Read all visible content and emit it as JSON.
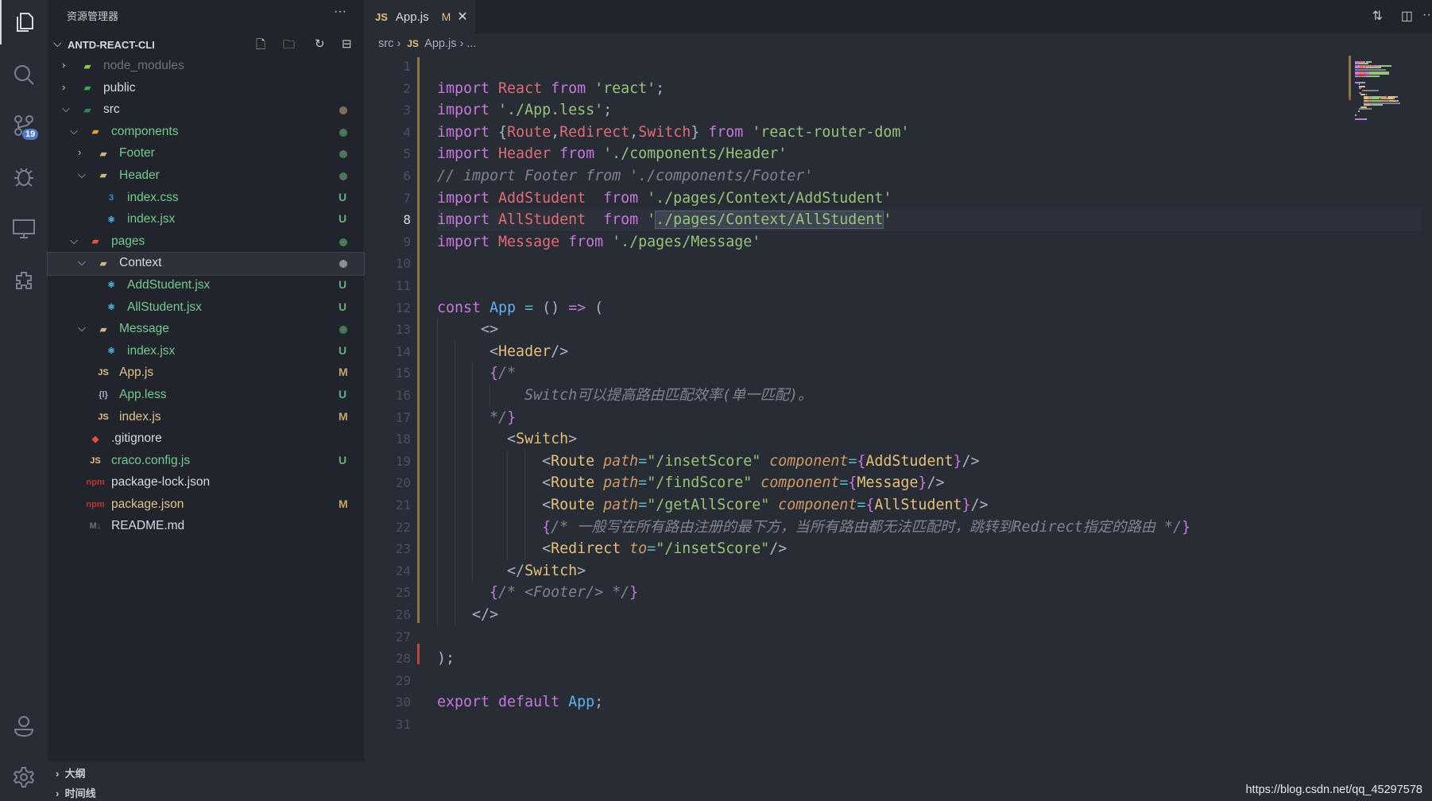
{
  "activity_bar": {
    "items": [
      {
        "icon": "files-icon",
        "active": true
      },
      {
        "icon": "search-icon"
      },
      {
        "icon": "source-control-icon",
        "badge": "19"
      },
      {
        "icon": "debug-icon"
      },
      {
        "icon": "remote-explorer-icon"
      },
      {
        "icon": "extensions-icon"
      }
    ],
    "bottom": [
      {
        "icon": "account-icon"
      },
      {
        "icon": "settings-gear-icon"
      }
    ]
  },
  "sidebar": {
    "title": "资源管理器",
    "more": "···",
    "project": "ANTD-REACT-CLI",
    "tree": [
      {
        "name": "node_modules",
        "depth": 0,
        "kind": "folder",
        "open": false,
        "icon": "nodejs-folder-icon",
        "color": "#6b717d"
      },
      {
        "name": "public",
        "depth": 0,
        "kind": "folder",
        "open": false,
        "icon": "public-folder-icon",
        "color": "#d7dae0"
      },
      {
        "name": "src",
        "depth": 0,
        "kind": "folder",
        "open": true,
        "icon": "src-folder-icon",
        "color": "#d7dae0",
        "dot": "#7d6f5e"
      },
      {
        "name": "components",
        "depth": 1,
        "kind": "folder",
        "open": true,
        "icon": "components-folder-icon",
        "color": "#73c991",
        "dot": "#4b7a5a"
      },
      {
        "name": "Footer",
        "depth": 2,
        "kind": "folder",
        "open": false,
        "icon": "folder-icon",
        "color": "#73c991",
        "dot": "#4b7a5a"
      },
      {
        "name": "Header",
        "depth": 2,
        "kind": "folder",
        "open": true,
        "icon": "folder-open-icon",
        "color": "#73c991",
        "dot": "#4b7a5a"
      },
      {
        "name": "index.css",
        "depth": 3,
        "kind": "file",
        "icon": "css-icon",
        "color": "#73c991",
        "status": "U"
      },
      {
        "name": "index.jsx",
        "depth": 3,
        "kind": "file",
        "icon": "react-icon",
        "color": "#73c991",
        "status": "U"
      },
      {
        "name": "pages",
        "depth": 1,
        "kind": "folder",
        "open": true,
        "icon": "pages-folder-icon",
        "color": "#73c991",
        "dot": "#4b7a5a"
      },
      {
        "name": "Context",
        "depth": 2,
        "kind": "folder",
        "open": true,
        "icon": "folder-open-icon",
        "color": "#d7dae0",
        "dot": "#8a8f98",
        "selected": true
      },
      {
        "name": "AddStudent.jsx",
        "depth": 3,
        "kind": "file",
        "icon": "react-icon",
        "color": "#73c991",
        "status": "U"
      },
      {
        "name": "AllStudent.jsx",
        "depth": 3,
        "kind": "file",
        "icon": "react-icon",
        "color": "#73c991",
        "status": "U"
      },
      {
        "name": "Message",
        "depth": 2,
        "kind": "folder",
        "open": true,
        "icon": "folder-open-icon",
        "color": "#73c991",
        "dot": "#4b7a5a"
      },
      {
        "name": "index.jsx",
        "depth": 3,
        "kind": "file",
        "icon": "react-icon",
        "color": "#73c991",
        "status": "U"
      },
      {
        "name": "App.js",
        "depth": 2,
        "kind": "file",
        "icon": "js-icon",
        "color": "#e2c08d",
        "status": "M"
      },
      {
        "name": "App.less",
        "depth": 2,
        "kind": "file",
        "icon": "less-icon",
        "color": "#73c991",
        "status": "U"
      },
      {
        "name": "index.js",
        "depth": 2,
        "kind": "file",
        "icon": "js-icon",
        "color": "#e2c08d",
        "status": "M"
      },
      {
        "name": ".gitignore",
        "depth": 1,
        "kind": "file",
        "icon": "git-icon",
        "color": "#d7dae0"
      },
      {
        "name": "craco.config.js",
        "depth": 1,
        "kind": "file",
        "icon": "js-icon",
        "color": "#73c991",
        "status": "U"
      },
      {
        "name": "package-lock.json",
        "depth": 1,
        "kind": "file",
        "icon": "npm-icon",
        "color": "#d7dae0"
      },
      {
        "name": "package.json",
        "depth": 1,
        "kind": "file",
        "icon": "npm-icon",
        "color": "#e2c08d",
        "status": "M"
      },
      {
        "name": "README.md",
        "depth": 1,
        "kind": "file",
        "icon": "markdown-icon",
        "color": "#d7dae0"
      }
    ],
    "panels": [
      "大纲",
      "时间线"
    ]
  },
  "tab": {
    "icon": "JS",
    "label": "App.js",
    "status": "M",
    "close": "✕"
  },
  "breadcrumb": {
    "folder": "src",
    "icon": "JS",
    "file": "App.js",
    "rest": "..."
  },
  "editor": {
    "current_line": 8,
    "lines": [
      [],
      [
        [
          "import ",
          "k"
        ],
        [
          "React ",
          "v"
        ],
        [
          "from ",
          "k"
        ],
        [
          "'react'",
          "s"
        ],
        [
          ";",
          "p"
        ]
      ],
      [
        [
          "import ",
          "k"
        ],
        [
          "'./App.less'",
          "s"
        ],
        [
          ";",
          "p"
        ]
      ],
      [
        [
          "import ",
          "k"
        ],
        [
          "{",
          "p"
        ],
        [
          "Route",
          "v"
        ],
        [
          ",",
          "p"
        ],
        [
          "Redirect",
          "v"
        ],
        [
          ",",
          "p"
        ],
        [
          "Switch",
          "v"
        ],
        [
          "} ",
          "p"
        ],
        [
          "from ",
          "k"
        ],
        [
          "'react-router-dom'",
          "s"
        ]
      ],
      [
        [
          "import ",
          "k"
        ],
        [
          "Header ",
          "v"
        ],
        [
          "from ",
          "k"
        ],
        [
          "'./components/Header'",
          "s"
        ]
      ],
      [
        [
          "// import Footer from './components/Footer'",
          "c"
        ]
      ],
      [
        [
          "import ",
          "k"
        ],
        [
          "AddStudent  ",
          "v"
        ],
        [
          "from ",
          "k"
        ],
        [
          "'./pages/Context/AddStudent'",
          "s"
        ]
      ],
      [
        [
          "import ",
          "k"
        ],
        [
          "AllStudent  ",
          "v"
        ],
        [
          "from ",
          "k"
        ],
        [
          "'",
          "s"
        ],
        [
          "./pages/Context/AllStudent",
          "s sel"
        ],
        [
          "'",
          "s"
        ]
      ],
      [
        [
          "import ",
          "k"
        ],
        [
          "Message ",
          "v"
        ],
        [
          "from ",
          "k"
        ],
        [
          "'./pages/Message'",
          "s"
        ]
      ],
      [],
      [],
      [
        [
          "const ",
          "k"
        ],
        [
          "App ",
          "f"
        ],
        [
          "= ",
          "o"
        ],
        [
          "() ",
          "p"
        ],
        [
          "=> ",
          "k"
        ],
        [
          "(",
          "p"
        ]
      ],
      [
        [
          "     <>",
          "p"
        ]
      ],
      [
        [
          "      <",
          "p"
        ],
        [
          "Header",
          "t"
        ],
        [
          "/>",
          "p"
        ]
      ],
      [
        [
          "      {",
          "b"
        ],
        [
          "/*",
          "c"
        ]
      ],
      [
        [
          "          Switch可以提高路由匹配效率(单一匹配)。",
          "c"
        ]
      ],
      [
        [
          "      */",
          "c"
        ],
        [
          "}",
          "b"
        ]
      ],
      [
        [
          "        <",
          "p"
        ],
        [
          "Switch",
          "t"
        ],
        [
          ">",
          "p"
        ]
      ],
      [
        [
          "            <",
          "p"
        ],
        [
          "Route ",
          "t"
        ],
        [
          "path",
          "a"
        ],
        [
          "=",
          "o"
        ],
        [
          "\"/insetScore\" ",
          "s"
        ],
        [
          "component",
          "a"
        ],
        [
          "=",
          "o"
        ],
        [
          "{",
          "b"
        ],
        [
          "AddStudent",
          "t"
        ],
        [
          "}",
          "b"
        ],
        [
          "/>",
          "p"
        ]
      ],
      [
        [
          "            <",
          "p"
        ],
        [
          "Route ",
          "t"
        ],
        [
          "path",
          "a"
        ],
        [
          "=",
          "o"
        ],
        [
          "\"/findScore\" ",
          "s"
        ],
        [
          "component",
          "a"
        ],
        [
          "=",
          "o"
        ],
        [
          "{",
          "b"
        ],
        [
          "Message",
          "t"
        ],
        [
          "}",
          "b"
        ],
        [
          "/>",
          "p"
        ]
      ],
      [
        [
          "            <",
          "p"
        ],
        [
          "Route ",
          "t"
        ],
        [
          "path",
          "a"
        ],
        [
          "=",
          "o"
        ],
        [
          "\"/getAllScore\" ",
          "s"
        ],
        [
          "component",
          "a"
        ],
        [
          "=",
          "o"
        ],
        [
          "{",
          "b"
        ],
        [
          "AllStudent",
          "t"
        ],
        [
          "}",
          "b"
        ],
        [
          "/>",
          "p"
        ]
      ],
      [
        [
          "            {",
          "b"
        ],
        [
          "/* 一般写在所有路由注册的最下方，当所有路由都无法匹配时，跳转到Redirect指定的路由 */",
          "c"
        ],
        [
          "}",
          "b"
        ]
      ],
      [
        [
          "            <",
          "p"
        ],
        [
          "Redirect ",
          "t"
        ],
        [
          "to",
          "a"
        ],
        [
          "=",
          "o"
        ],
        [
          "\"/insetScore\"",
          "s"
        ],
        [
          "/>",
          "p"
        ]
      ],
      [
        [
          "        </",
          "p"
        ],
        [
          "Switch",
          "t"
        ],
        [
          ">",
          "p"
        ]
      ],
      [
        [
          "      {",
          "b"
        ],
        [
          "/* <Footer/> */",
          "c"
        ],
        [
          "}",
          "b"
        ]
      ],
      [
        [
          "    </>",
          "p"
        ]
      ],
      [],
      [
        [
          ");",
          "p"
        ]
      ],
      [],
      [
        [
          "export ",
          "k"
        ],
        [
          "default ",
          "k"
        ],
        [
          "App",
          "f"
        ],
        [
          ";",
          "p"
        ]
      ],
      []
    ]
  },
  "watermark": "https://blog.csdn.net/qq_45297578"
}
